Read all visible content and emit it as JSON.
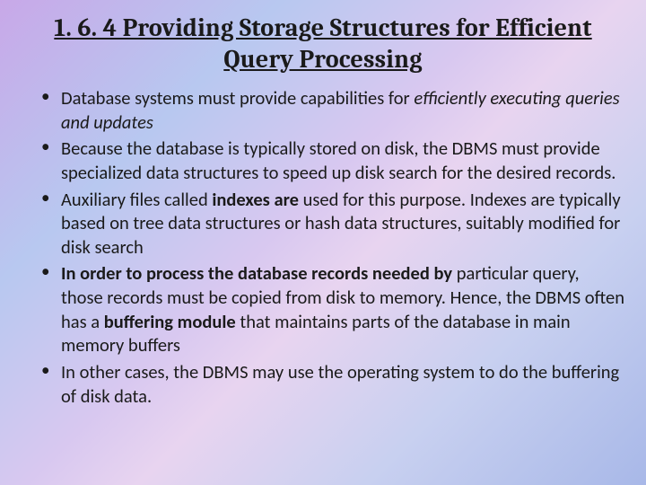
{
  "title": "1. 6. 4 Providing Storage Structures for Efficient Query Processing",
  "bullets": {
    "b1_pre": "Database systems must provide capabilities for ",
    "b1_italic": "efficiently executing queries and updates",
    "b2": "Because the database is typically stored on disk, the DBMS must provide specialized data structures to speed up disk search for the desired records.",
    "b3_pre": "Auxiliary files called ",
    "b3_bold": "indexes are ",
    "b3_post": "used for this purpose. Indexes are typically based on tree data structures or hash data structures, suitably modified for disk search",
    "b4_space": " ",
    "b4_bold1": "In order to process the database records needed by ",
    "b4_mid1": " particular query, those records must be copied from disk to memory. Hence, the DBMS often has a ",
    "b4_bold2": "buffering module ",
    "b4_post": "that maintains parts of the database in main memory buffers",
    "b5": "In other cases, the DBMS may use the operating system to do the buffering of disk data."
  }
}
